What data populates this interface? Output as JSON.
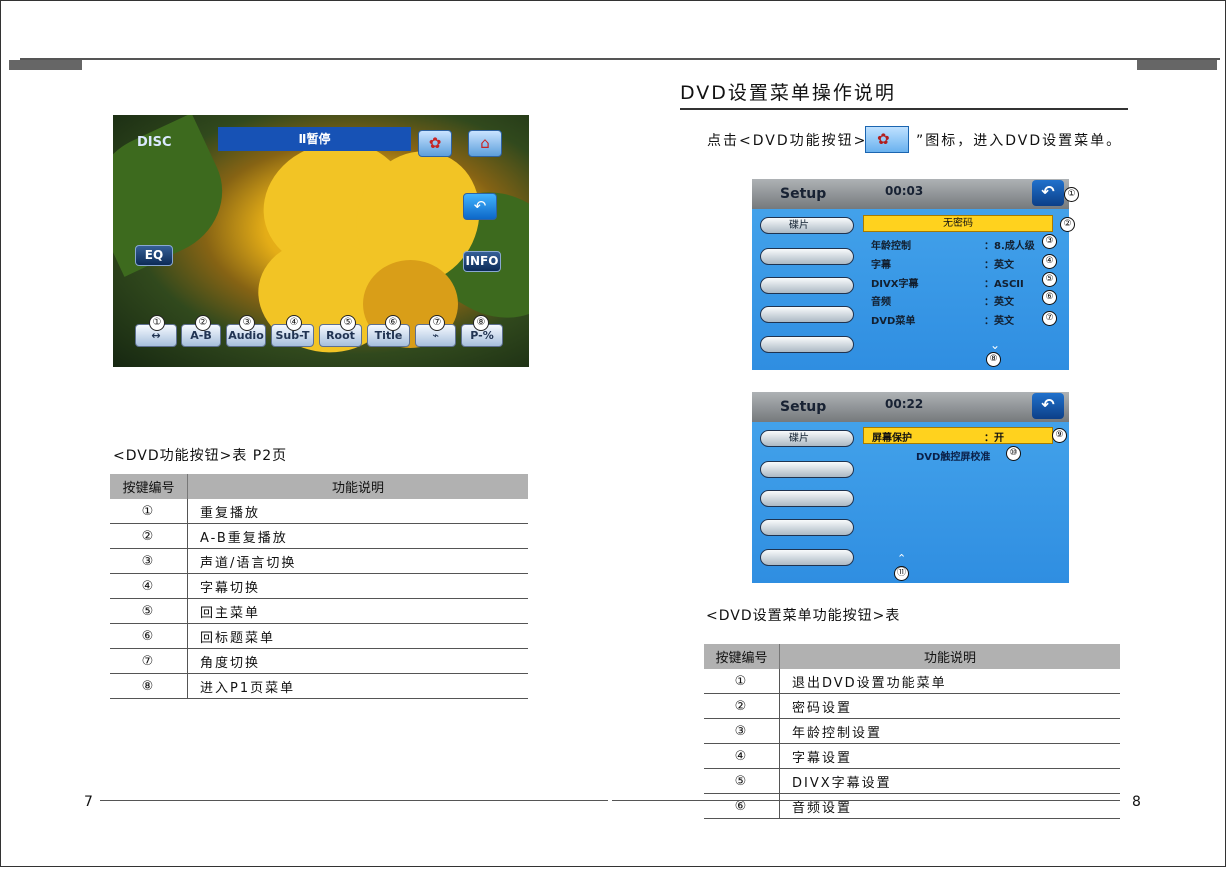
{
  "header": {
    "title": "DVD设置菜单操作说明",
    "intro_before": "点击<DVD功能按钮>“",
    "intro_after": "”图标，进入DVD设置菜单。"
  },
  "left_screen": {
    "disc": "DISC",
    "status": "Ⅱ暂停",
    "eq": "EQ",
    "info": "INFO",
    "buttons": [
      "↔",
      "A-B",
      "Audio",
      "Sub-T",
      "Root",
      "Title",
      "⌁",
      "P-%"
    ],
    "numbers": [
      "①",
      "②",
      "③",
      "④",
      "⑤",
      "⑥",
      "⑦",
      "⑧"
    ]
  },
  "left_table": {
    "caption": "<DVD功能按钮>表 P2页",
    "headers": [
      "按键编号",
      "功能说明"
    ],
    "rows": [
      [
        "①",
        "重复播放"
      ],
      [
        "②",
        "A-B重复播放"
      ],
      [
        "③",
        "声道/语言切换"
      ],
      [
        "④",
        "字幕切换"
      ],
      [
        "⑤",
        "回主菜单"
      ],
      [
        "⑥",
        "回标题菜单"
      ],
      [
        "⑦",
        "角度切换"
      ],
      [
        "⑧",
        "进入P1页菜单"
      ]
    ]
  },
  "setup_screen_1": {
    "title": "Setup",
    "time": "00:03",
    "side_label": "碟片",
    "highlight": "无密码",
    "rows": [
      [
        "年龄控制",
        "：8.成人级"
      ],
      [
        "字幕",
        "：英文"
      ],
      [
        "DIVX字幕",
        "：ASCII"
      ],
      [
        "音频",
        "：英文"
      ],
      [
        "DVD菜单",
        "：英文"
      ]
    ],
    "markers": [
      "①",
      "②",
      "③",
      "④",
      "⑤",
      "⑥",
      "⑦",
      "⑧"
    ]
  },
  "setup_screen_2": {
    "title": "Setup",
    "time": "00:22",
    "side_label": "碟片",
    "highlight_label": "屏幕保护",
    "highlight_value": "：开",
    "line": "DVD触控屏校准",
    "markers": [
      "⑨",
      "⑩",
      "⑪"
    ]
  },
  "right_table": {
    "caption": "<DVD设置菜单功能按钮>表",
    "headers": [
      "按键编号",
      "功能说明"
    ],
    "rows": [
      [
        "①",
        "退出DVD设置功能菜单"
      ],
      [
        "②",
        "密码设置"
      ],
      [
        "③",
        "年龄控制设置"
      ],
      [
        "④",
        "字幕设置"
      ],
      [
        "⑤",
        "DIVX字幕设置"
      ],
      [
        "⑥",
        "音频设置"
      ]
    ]
  },
  "footer": {
    "left_page": "7",
    "right_page": "8"
  }
}
